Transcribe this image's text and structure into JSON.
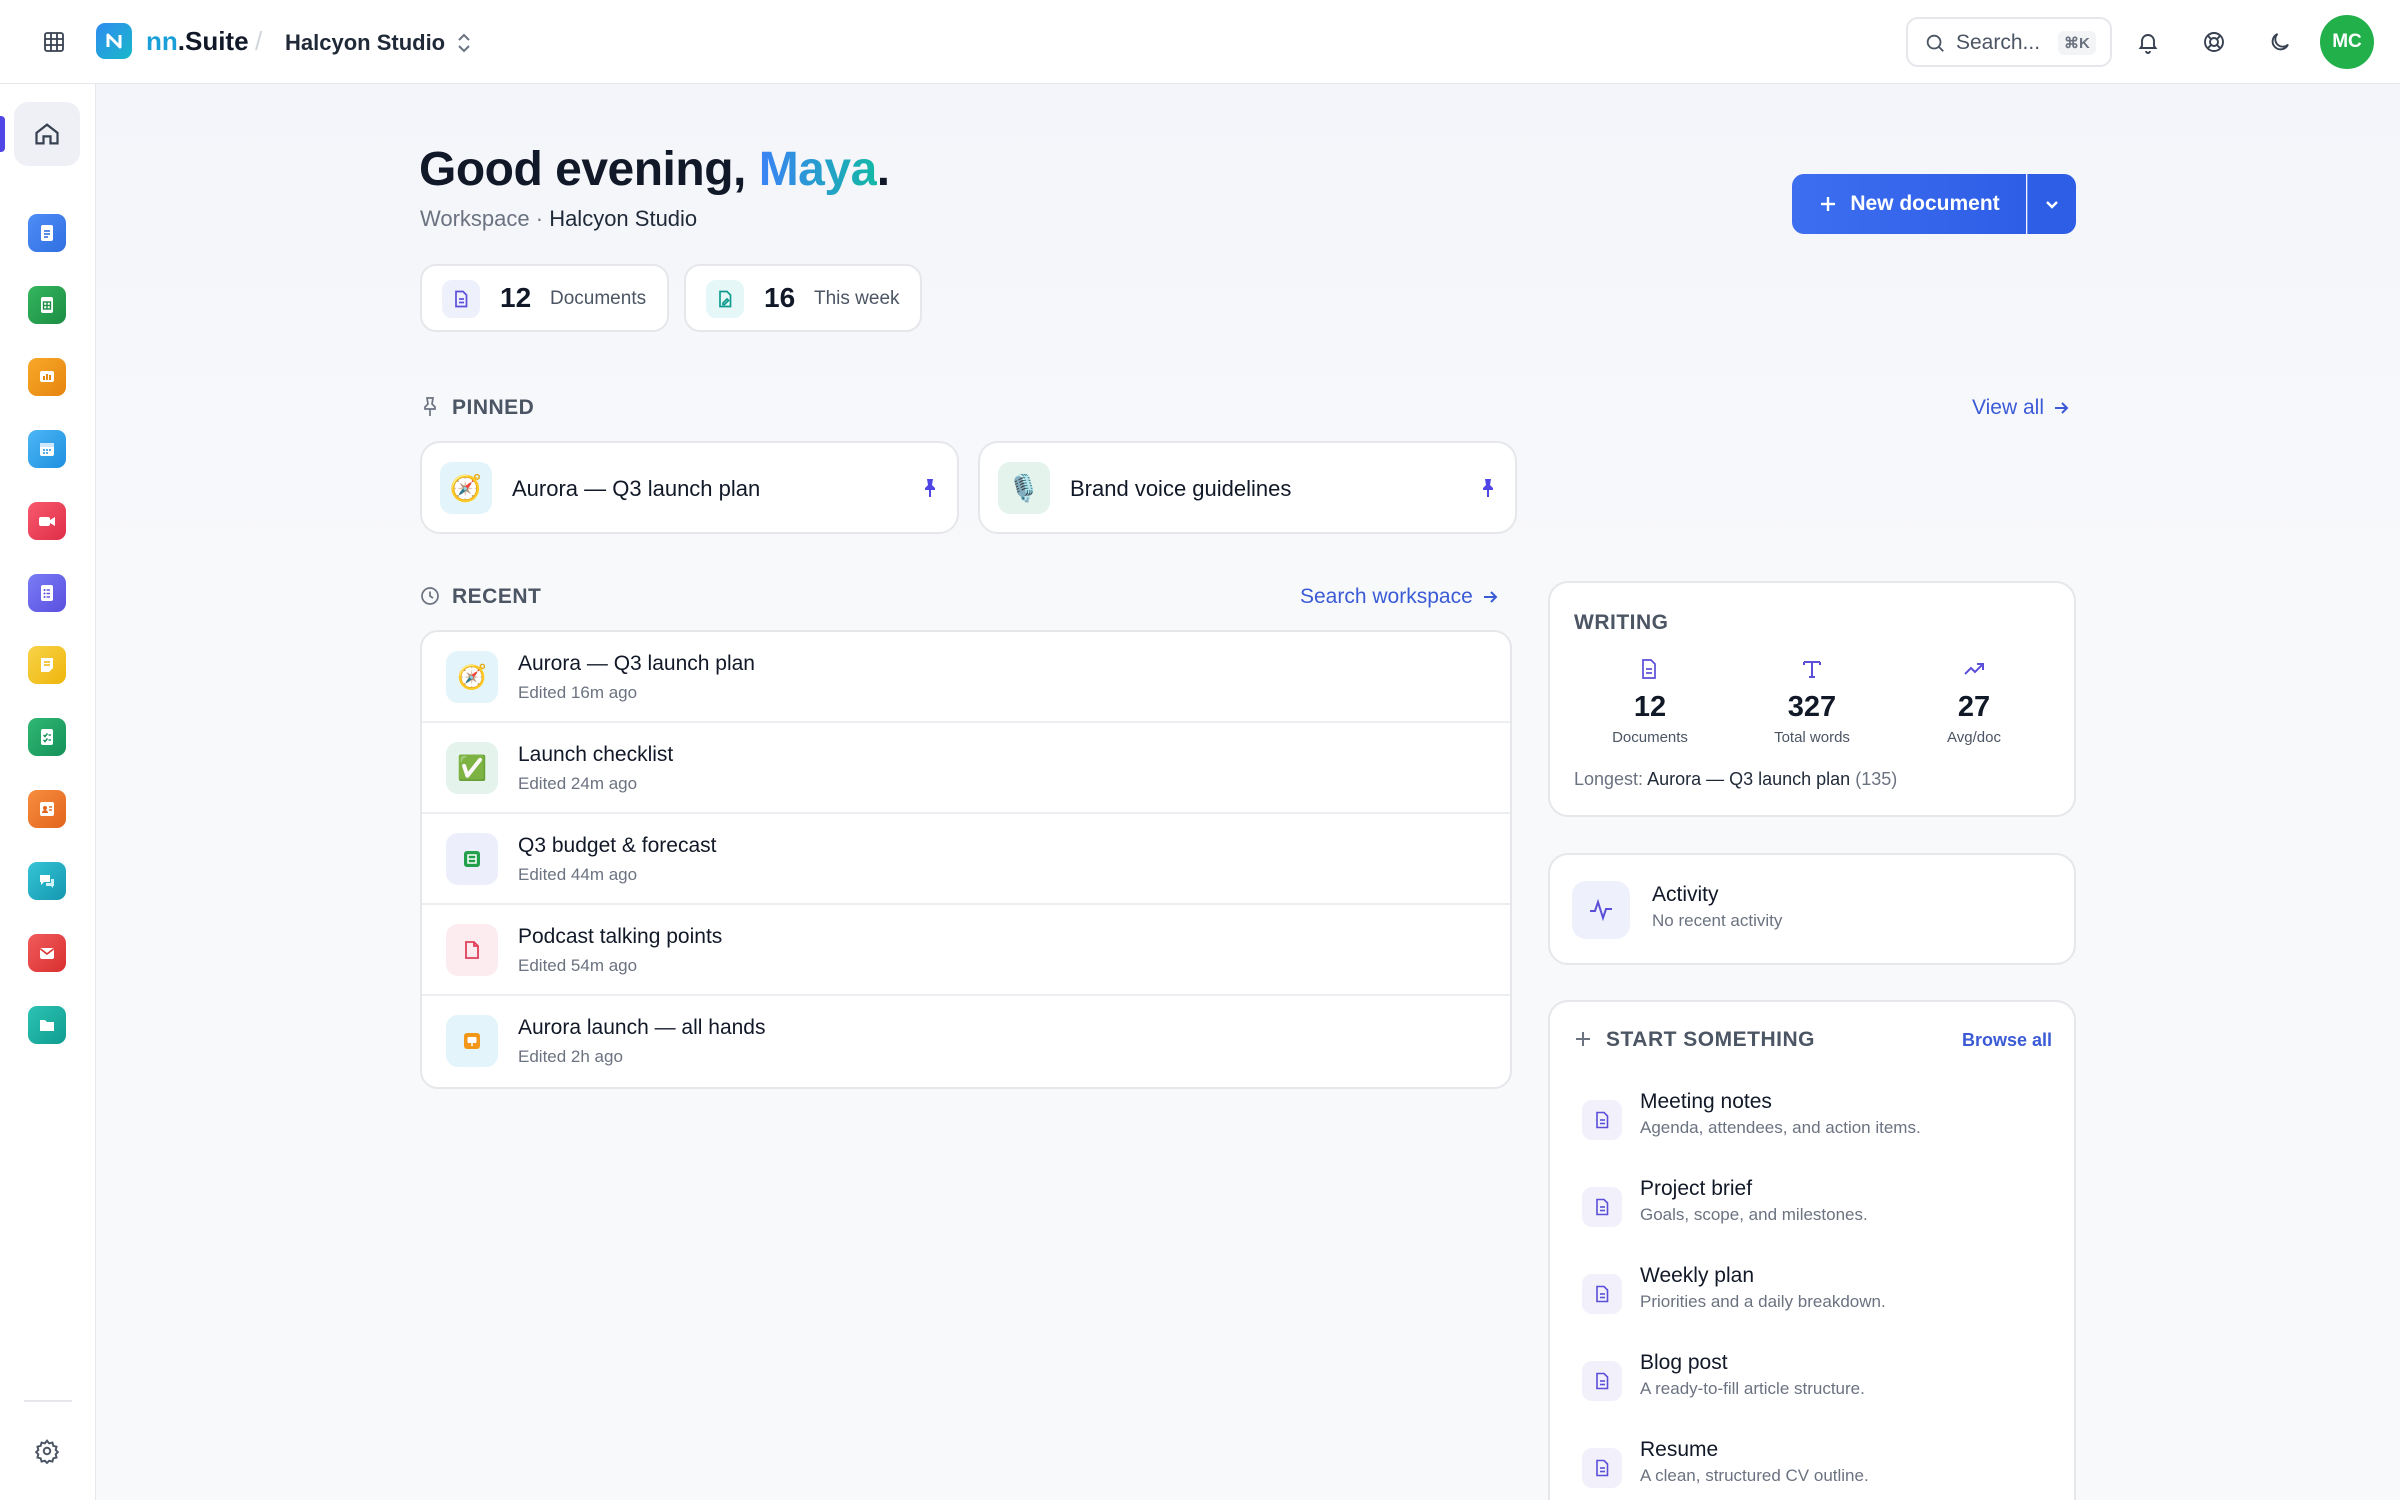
{
  "topbar": {
    "brand_prefix": "nn",
    "brand_suffix": ".Suite",
    "workspace_name": "Halcyon Studio",
    "search_placeholder": "Search...",
    "search_shortcut": "⌘K",
    "avatar_initials": "MC"
  },
  "sidebar": {
    "apps": [
      {
        "icon": "home-icon",
        "color": "#eef0f6"
      },
      {
        "icon": "docs-icon",
        "color": "#3b82f6"
      },
      {
        "icon": "sheets-icon",
        "color": "#22a04b"
      },
      {
        "icon": "slides-icon",
        "color": "#f59e0b"
      },
      {
        "icon": "calendar-icon",
        "color": "#38a8f0"
      },
      {
        "icon": "video-icon",
        "color": "#f0435b"
      },
      {
        "icon": "forms-icon",
        "color": "#6366f1"
      },
      {
        "icon": "notes-icon",
        "color": "#f3c623"
      },
      {
        "icon": "tasks-icon",
        "color": "#20a464"
      },
      {
        "icon": "contacts-icon",
        "color": "#f0782c"
      },
      {
        "icon": "chat-icon",
        "color": "#1fb5c9"
      },
      {
        "icon": "mail-icon",
        "color": "#ef4444"
      },
      {
        "icon": "files-icon",
        "color": "#14b8a6"
      }
    ]
  },
  "greeting": {
    "prefix": "Good evening, ",
    "name": "Maya",
    "suffix": ".",
    "workspace_label": "Workspace · ",
    "workspace_name": "Halcyon Studio"
  },
  "stats": {
    "documents_count": "12",
    "documents_label": "Documents",
    "week_count": "16",
    "week_label": "This week"
  },
  "actions": {
    "new_document": "New document"
  },
  "pinned": {
    "heading": "PINNED",
    "view_all": "View all",
    "items": [
      {
        "title": "Aurora — Q3 launch plan",
        "emoji": "🧭"
      },
      {
        "title": "Brand voice guidelines",
        "emoji": "🎙️"
      }
    ]
  },
  "recent": {
    "heading": "RECENT",
    "search_link": "Search workspace",
    "items": [
      {
        "title": "Aurora — Q3 launch plan",
        "subtitle": "Edited 16m ago",
        "emoji": "🧭"
      },
      {
        "title": "Launch checklist",
        "subtitle": "Edited 24m ago",
        "emoji": "✅"
      },
      {
        "title": "Q3 budget & forecast",
        "subtitle": "Edited 44m ago",
        "emoji": "sheet"
      },
      {
        "title": "Podcast talking points",
        "subtitle": "Edited 54m ago",
        "emoji": "doc"
      },
      {
        "title": "Aurora launch — all hands",
        "subtitle": "Edited 2h ago",
        "emoji": "slides"
      }
    ]
  },
  "writing": {
    "heading": "WRITING",
    "documents_value": "12",
    "documents_label": "Documents",
    "words_value": "327",
    "words_label": "Total words",
    "avg_value": "27",
    "avg_label": "Avg/doc",
    "longest_label": "Longest: ",
    "longest_title": "Aurora — Q3 launch plan",
    "longest_count": " (135)"
  },
  "activity": {
    "title": "Activity",
    "subtitle": "No recent activity"
  },
  "start": {
    "heading": "START SOMETHING",
    "browse_all": "Browse all",
    "templates": [
      {
        "title": "Meeting notes",
        "subtitle": "Agenda, attendees, and action items."
      },
      {
        "title": "Project brief",
        "subtitle": "Goals, scope, and milestones."
      },
      {
        "title": "Weekly plan",
        "subtitle": "Priorities and a daily breakdown."
      },
      {
        "title": "Blog post",
        "subtitle": "A ready-to-fill article structure."
      },
      {
        "title": "Resume",
        "subtitle": "A clean, structured CV outline."
      }
    ]
  },
  "colors": {
    "accent": "#2f5fe8",
    "accent_text": "#3b5bd6",
    "greeting_name_gradient_start": "#3b82f6",
    "greeting_name_gradient_end": "#14b8a6",
    "avatar": "#22b04b"
  }
}
